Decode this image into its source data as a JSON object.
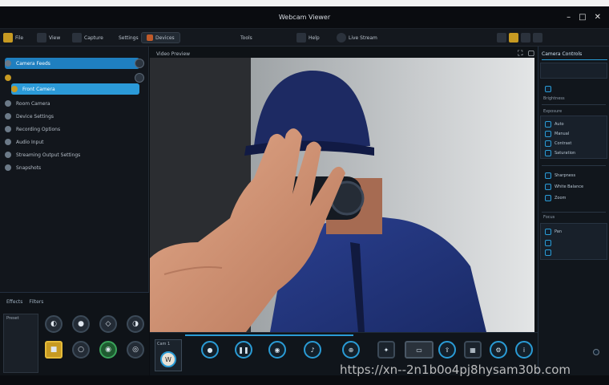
{
  "window": {
    "title": "Webcam Viewer"
  },
  "toolbar": {
    "items": [
      "File",
      "View",
      "Capture",
      "Settings",
      "Devices",
      "Tools",
      "Help"
    ],
    "center_label": "Live Stream"
  },
  "sidebar": {
    "items": [
      {
        "label": "Camera Feeds",
        "state": "selected"
      },
      {
        "label": "Front Camera",
        "state": "active"
      },
      {
        "label": "Room Camera",
        "state": "normal"
      },
      {
        "label": "Device Settings",
        "state": "normal"
      },
      {
        "label": "Recording Options",
        "state": "normal"
      },
      {
        "label": "Audio Input",
        "state": "normal"
      },
      {
        "label": "Streaming Output Settings",
        "state": "normal"
      },
      {
        "label": "Snapshots",
        "state": "normal"
      }
    ]
  },
  "left_panel": {
    "header_a": "Effects",
    "header_b": "Filters",
    "thumb_label": "Preset"
  },
  "viewer": {
    "header": "Video Preview"
  },
  "controls": {
    "thumb_label": "Cam 1",
    "logo_text": "W"
  },
  "right_panel": {
    "header": "Camera Controls",
    "section_a": "Brightness",
    "section_b": "Exposure",
    "section_c": "Focus",
    "items": [
      "Auto",
      "Manual",
      "Contrast",
      "Saturation",
      "Sharpness",
      "White Balance",
      "Zoom",
      "Pan"
    ]
  },
  "watermark": "https://xn--2n1b0o4pj8hysam30b.com",
  "colors": {
    "accent": "#2a9bd5",
    "panel": "#12161c",
    "background": "#0b0e12"
  }
}
